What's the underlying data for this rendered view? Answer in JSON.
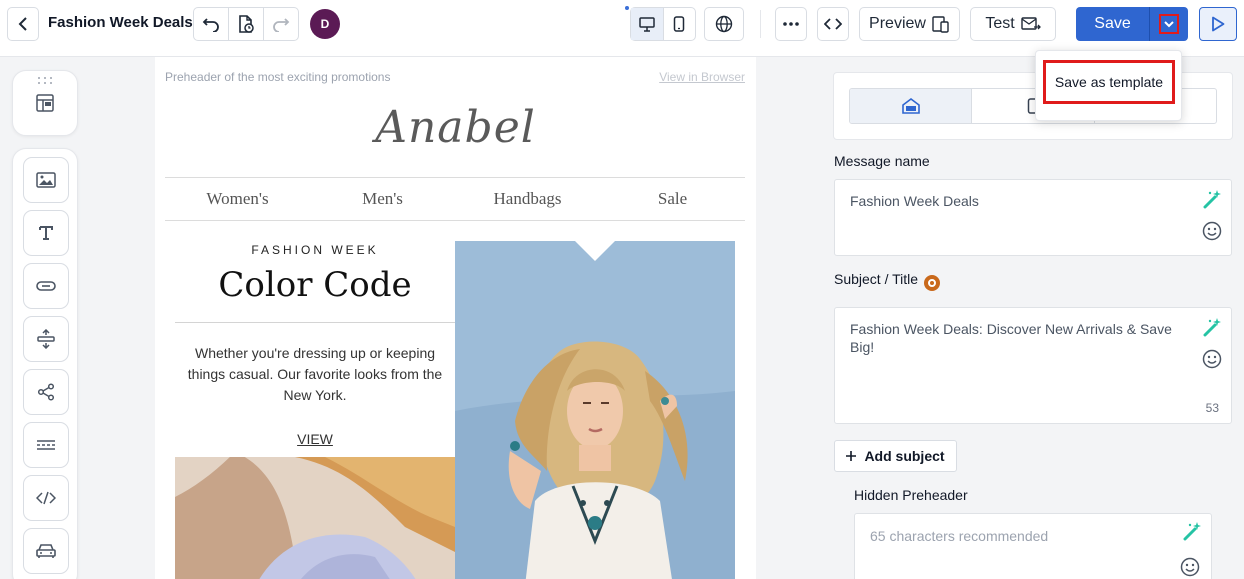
{
  "header": {
    "title": "Fashion Week Deals",
    "avatar_initial": "D",
    "preview_label": "Preview",
    "test_label": "Test",
    "save_label": "Save",
    "brand_color": "#2f66d0"
  },
  "save_menu": {
    "items": [
      {
        "label": "Save as template",
        "highlighted": true
      }
    ]
  },
  "toolbox": {
    "tools": [
      "image-icon",
      "text-icon",
      "button-icon",
      "spacer-icon",
      "social-icon",
      "divider-icon",
      "code-icon",
      "product-icon"
    ]
  },
  "email": {
    "preheader": "Preheader of the most exciting promotions",
    "view_in_browser": "View in Browser",
    "logo_text": "Anabel",
    "nav": [
      "Women's",
      "Men's",
      "Handbags",
      "Sale"
    ],
    "eyebrow": "FASHION WEEK",
    "headline": "Color Code",
    "body": "Whether you're dressing up or keeping things casual. Our favorite looks from the New York.",
    "cta": "VIEW"
  },
  "settings": {
    "message_name_label": "Message name",
    "message_name_value": "Fashion Week Deals",
    "subject_label": "Subject / Title",
    "subject_value": "Fashion Week Deals: Discover New Arrivals & Save Big!",
    "subject_counter": "53",
    "add_subject_label": "Add subject",
    "hidden_preheader_label": "Hidden Preheader",
    "hidden_preheader_placeholder": "65 characters recommended"
  }
}
